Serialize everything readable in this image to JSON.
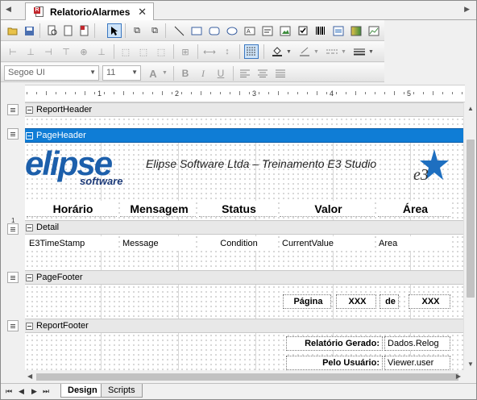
{
  "document_tab": {
    "title": "RelatorioAlarmes",
    "close": "✕"
  },
  "font_toolbar": {
    "font_name": "Segoe UI",
    "font_size": "11"
  },
  "ruler": {
    "marks": [
      "1",
      "2",
      "3",
      "4",
      "5"
    ]
  },
  "bands": [
    {
      "name": "ReportHeader"
    },
    {
      "name": "PageHeader"
    },
    {
      "name": "Detail"
    },
    {
      "name": "PageFooter"
    },
    {
      "name": "ReportFooter"
    }
  ],
  "page_header": {
    "logo_main": "elipse",
    "logo_sub": "software",
    "company_title": "Elipse Software Ltda – Treinamento E3 Studio",
    "e3_logo_text": "e3",
    "columns": [
      "Horário",
      "Mensagem",
      "Status",
      "Valor",
      "Área"
    ]
  },
  "detail": {
    "fields": [
      "E3TimeStamp",
      "Message",
      "Condition",
      "CurrentValue",
      "Area"
    ]
  },
  "page_footer": {
    "page_label": "Página",
    "page_value": "XXX",
    "of_label": "de",
    "total_value": "XXX"
  },
  "report_footer": {
    "generated_label": "Relatório Gerado:",
    "generated_value": "Dados.Relog",
    "user_label": "Pelo Usuário:",
    "user_value": "Viewer.user"
  },
  "bottom_tabs": [
    "Design",
    "Scripts"
  ],
  "colors": {
    "selected_band": "#0f7dd6",
    "logo_blue": "#1c5fab"
  }
}
